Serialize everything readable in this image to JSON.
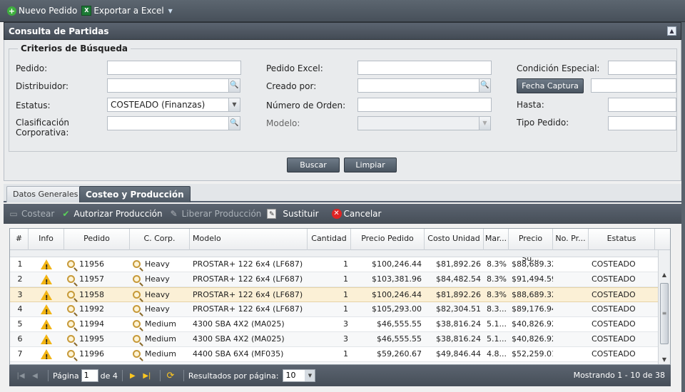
{
  "toolbar": {
    "nuevo_label": "Nuevo Pedido",
    "exportar_label": "Exportar a Excel"
  },
  "panel": {
    "title": "Consulta de Partidas"
  },
  "criterios": {
    "legend": "Criterios de Búsqueda",
    "pedido_label": "Pedido:",
    "distribuidor_label": "Distribuidor:",
    "estatus_label": "Estatus:",
    "estatus_value": "COSTEADO (Finanzas)",
    "clasificacion_label": "Clasificación\nCorporativa:",
    "pedido_excel_label": "Pedido Excel:",
    "creado_por_label": "Creado por:",
    "numero_orden_label": "Número de Orden:",
    "modelo_label": "Modelo:",
    "condicion_label": "Condición Especial:",
    "fecha_captura_label": "Fecha Captura",
    "hasta_label": "Hasta:",
    "tipo_pedido_label": "Tipo Pedido:",
    "buscar_label": "Buscar",
    "limpiar_label": "Limpiar"
  },
  "tabs": [
    {
      "label": "Datos Generales"
    },
    {
      "label": "Costeo y Producción"
    }
  ],
  "grid_toolbar": {
    "costear_label": "Costear",
    "autorizar_label": "Autorizar Producción",
    "liberar_label": "Liberar Producción",
    "sustituir_label": "Sustituir",
    "cancelar_label": "Cancelar"
  },
  "grid": {
    "columns": [
      "#",
      "Info",
      "Pedido",
      "C. Corp.",
      "Modelo",
      "Cantidad",
      "Precio Pedido",
      "Costo Unidad",
      "Mar...",
      "Precio Su...",
      "No. Pr...",
      "Estatus"
    ],
    "rows": [
      {
        "num": "1",
        "pedido": "11956",
        "ccorp": "Heavy",
        "modelo": "PROSTAR+ 122 6x4 (LF687)",
        "cantidad": "1",
        "precio": "$100,246.44",
        "costo": "$81,892.26",
        "mar": "8.3%",
        "precio_su": "$88,689.32",
        "estatus": "COSTEADO"
      },
      {
        "num": "2",
        "pedido": "11957",
        "ccorp": "Heavy",
        "modelo": "PROSTAR+ 122 6x4 (LF687)",
        "cantidad": "1",
        "precio": "$103,381.96",
        "costo": "$84,482.54",
        "mar": "8.3%",
        "precio_su": "$91,494.59",
        "estatus": "COSTEADO"
      },
      {
        "num": "3",
        "pedido": "11958",
        "ccorp": "Heavy",
        "modelo": "PROSTAR+ 122 6x4 (LF687)",
        "cantidad": "1",
        "precio": "$100,246.44",
        "costo": "$81,892.26",
        "mar": "8.3%",
        "precio_su": "$88,689.32",
        "estatus": "COSTEADO"
      },
      {
        "num": "4",
        "pedido": "11992",
        "ccorp": "Heavy",
        "modelo": "PROSTAR+ 122 6x4 (LF687)",
        "cantidad": "1",
        "precio": "$105,293.00",
        "costo": "$82,304.51",
        "mar": "8.3...",
        "precio_su": "$89,176.94",
        "estatus": "COSTEADO"
      },
      {
        "num": "5",
        "pedido": "11994",
        "ccorp": "Medium",
        "modelo": "4300 SBA 4X2 (MA025)",
        "cantidad": "3",
        "precio": "$46,555.55",
        "costo": "$38,816.24",
        "mar": "5.1...",
        "precio_su": "$40,826.92",
        "estatus": "COSTEADO"
      },
      {
        "num": "6",
        "pedido": "11995",
        "ccorp": "Medium",
        "modelo": "4300 SBA 4X2 (MA025)",
        "cantidad": "3",
        "precio": "$46,555.55",
        "costo": "$38,816.24",
        "mar": "5.1...",
        "precio_su": "$40,826.92",
        "estatus": "COSTEADO"
      },
      {
        "num": "7",
        "pedido": "11996",
        "ccorp": "Medium",
        "modelo": "4400 SBA 6X4 (MF035)",
        "cantidad": "1",
        "precio": "$59,260.67",
        "costo": "$49,846.44",
        "mar": "4.8...",
        "precio_su": "$52,259.01",
        "estatus": "COSTEADO"
      }
    ],
    "selected_row": 3
  },
  "paging": {
    "page_label": "Página",
    "page_value": "1",
    "of_label": "de 4",
    "per_page_label": "Resultados por página:",
    "per_page_value": "10",
    "display": "Mostrando 1 - 10 de 38"
  }
}
